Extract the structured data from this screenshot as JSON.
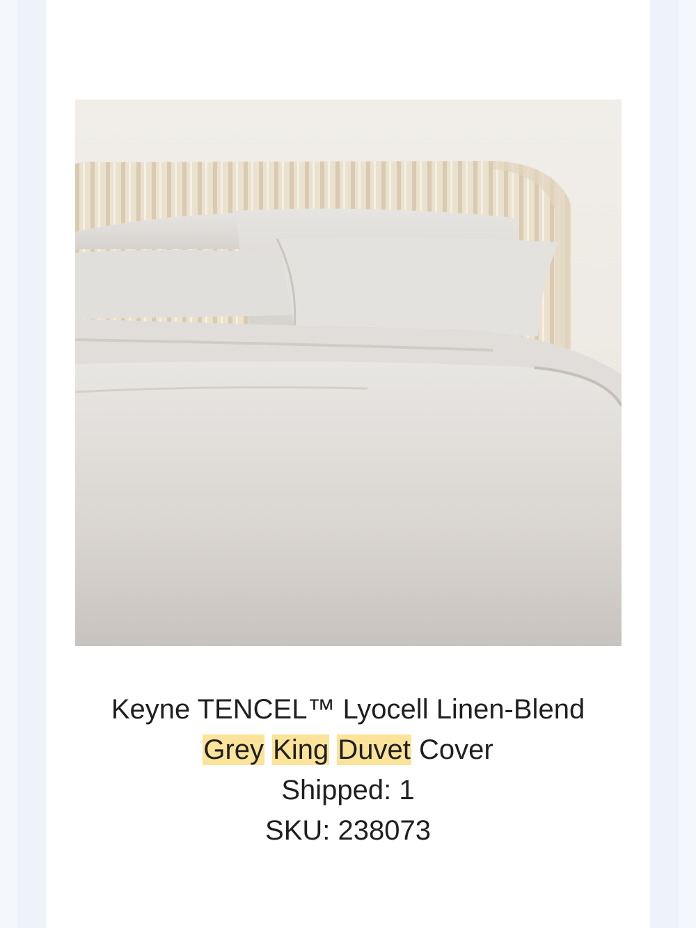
{
  "colors": {
    "page_bg": "#eef2f9",
    "panel_bg": "#ffffff",
    "highlight": "#fbe49a",
    "text": "#1f1f1f"
  },
  "product": {
    "image_alt": "Grey linen duvet cover on a bed with a pleated cream headboard",
    "title_line1": "Keyne TENCEL™ Lyocell Linen-Blend",
    "title_line2": {
      "word1": "Grey",
      "word2": "King",
      "word3": "Duvet",
      "word4": "Cover"
    },
    "shipped": "Shipped: 1",
    "sku": "SKU: 238073"
  }
}
